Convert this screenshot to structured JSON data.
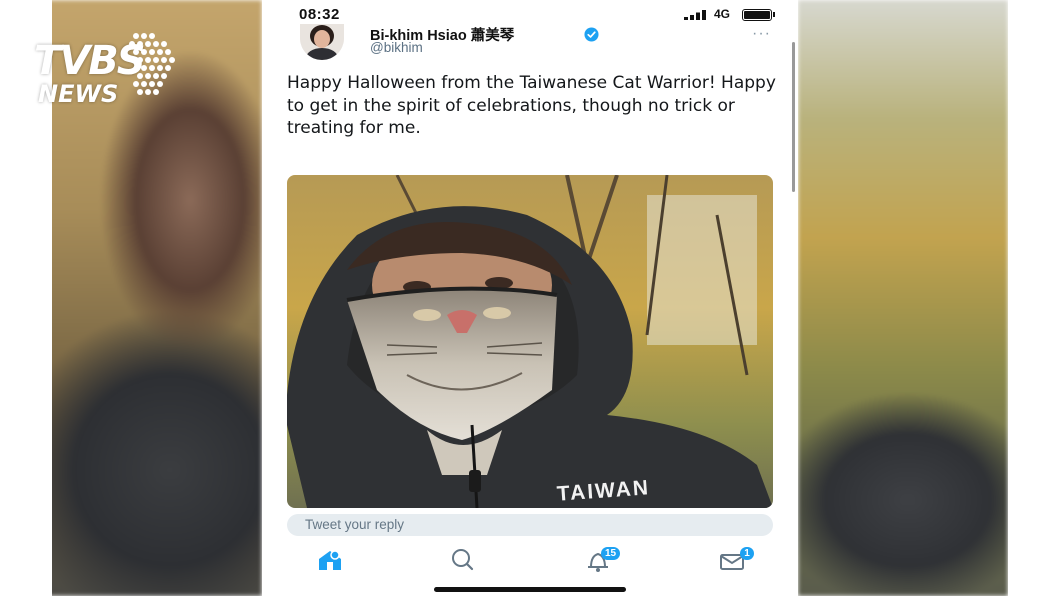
{
  "logo": {
    "brand": "TVBS",
    "sub": "NEWS"
  },
  "status_bar": {
    "time": "08:32",
    "network": "4G"
  },
  "tweet": {
    "author_name": "Bi-khim Hsiao 蕭美琴",
    "handle": "@bikhim",
    "verified": true,
    "more_label": "···",
    "text": "Happy Halloween from the Taiwanese Cat Warrior!  Happy to get in the spirit of celebrations, though no trick or treating for me.",
    "photo_jacket_text": "TAIWAN"
  },
  "reply": {
    "placeholder": "Tweet your reply"
  },
  "tabbar": {
    "items": [
      {
        "name": "home",
        "icon": "home-icon"
      },
      {
        "name": "search",
        "icon": "search-icon"
      },
      {
        "name": "notifications",
        "icon": "bell-icon",
        "badge": "15"
      },
      {
        "name": "messages",
        "icon": "mail-icon",
        "badge": "1"
      }
    ]
  },
  "colors": {
    "accent": "#1da1f2",
    "text": "#14171a",
    "muted": "#657786"
  }
}
